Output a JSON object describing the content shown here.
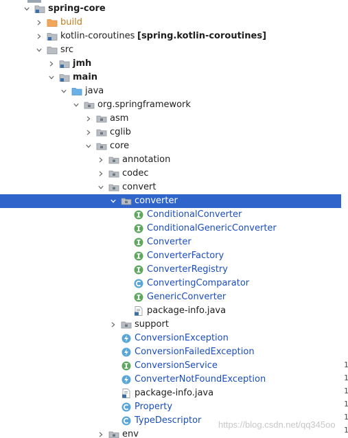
{
  "tree": {
    "rows": [
      {
        "label": "spring-core",
        "kind": "module",
        "depth": 0,
        "expanded": true,
        "bold": true
      },
      {
        "label": "build",
        "kind": "folder-orange",
        "depth": 1,
        "expanded": false,
        "color": "orange"
      },
      {
        "label": "kotlin-coroutines",
        "suffix": "[spring.kotlin-coroutines]",
        "kind": "module",
        "depth": 1,
        "expanded": false
      },
      {
        "label": "src",
        "kind": "folder",
        "depth": 1,
        "expanded": true
      },
      {
        "label": "jmh",
        "kind": "source-folder",
        "depth": 2,
        "expanded": false,
        "bold": true
      },
      {
        "label": "main",
        "kind": "source-folder",
        "depth": 2,
        "expanded": true,
        "bold": true
      },
      {
        "label": "java",
        "kind": "folder-blue",
        "depth": 3,
        "expanded": true
      },
      {
        "label": "org.springframework",
        "kind": "package",
        "depth": 4,
        "expanded": true
      },
      {
        "label": "asm",
        "kind": "package",
        "depth": 5,
        "expanded": false
      },
      {
        "label": "cglib",
        "kind": "package",
        "depth": 5,
        "expanded": false
      },
      {
        "label": "core",
        "kind": "package",
        "depth": 5,
        "expanded": true
      },
      {
        "label": "annotation",
        "kind": "package",
        "depth": 6,
        "expanded": false
      },
      {
        "label": "codec",
        "kind": "package",
        "depth": 6,
        "expanded": false
      },
      {
        "label": "convert",
        "kind": "package",
        "depth": 6,
        "expanded": true
      },
      {
        "label": "converter",
        "kind": "package",
        "depth": 7,
        "expanded": true,
        "selected": true
      },
      {
        "label": "ConditionalConverter",
        "kind": "interface",
        "depth": 8,
        "color": "blue"
      },
      {
        "label": "ConditionalGenericConverter",
        "kind": "interface",
        "depth": 8,
        "color": "blue"
      },
      {
        "label": "Converter",
        "kind": "interface",
        "depth": 8,
        "color": "blue"
      },
      {
        "label": "ConverterFactory",
        "kind": "interface",
        "depth": 8,
        "color": "blue"
      },
      {
        "label": "ConverterRegistry",
        "kind": "interface",
        "depth": 8,
        "color": "blue"
      },
      {
        "label": "ConvertingComparator",
        "kind": "class",
        "depth": 8,
        "color": "blue"
      },
      {
        "label": "GenericConverter",
        "kind": "interface",
        "depth": 8,
        "color": "blue"
      },
      {
        "label": "package-info.java",
        "kind": "java-file",
        "depth": 8
      },
      {
        "label": "support",
        "kind": "package",
        "depth": 7,
        "expanded": false
      },
      {
        "label": "ConversionException",
        "kind": "exception",
        "depth": 7,
        "color": "blue"
      },
      {
        "label": "ConversionFailedException",
        "kind": "exception",
        "depth": 7,
        "color": "blue"
      },
      {
        "label": "ConversionService",
        "kind": "interface",
        "depth": 7,
        "color": "blue"
      },
      {
        "label": "ConverterNotFoundException",
        "kind": "exception",
        "depth": 7,
        "color": "blue"
      },
      {
        "label": "package-info.java",
        "kind": "java-file",
        "depth": 7
      },
      {
        "label": "Property",
        "kind": "class",
        "depth": 7,
        "color": "blue"
      },
      {
        "label": "TypeDescriptor",
        "kind": "class",
        "depth": 7,
        "color": "blue"
      },
      {
        "label": "env",
        "kind": "package",
        "depth": 6,
        "expanded": false
      }
    ]
  },
  "gutter": {
    "numbers": [
      "1",
      "1",
      "1",
      "1",
      "1",
      "1"
    ]
  },
  "watermark": {
    "text": "https://blog.csdn.net/qq345oo"
  },
  "colors": {
    "selection": "#2f65ca",
    "class_label": "#1a4dbd",
    "excluded_folder": "#c37a1a",
    "interface_icon": "#5fa85f",
    "class_icon": "#5aa6d6",
    "package_icon": "#8a9199"
  }
}
